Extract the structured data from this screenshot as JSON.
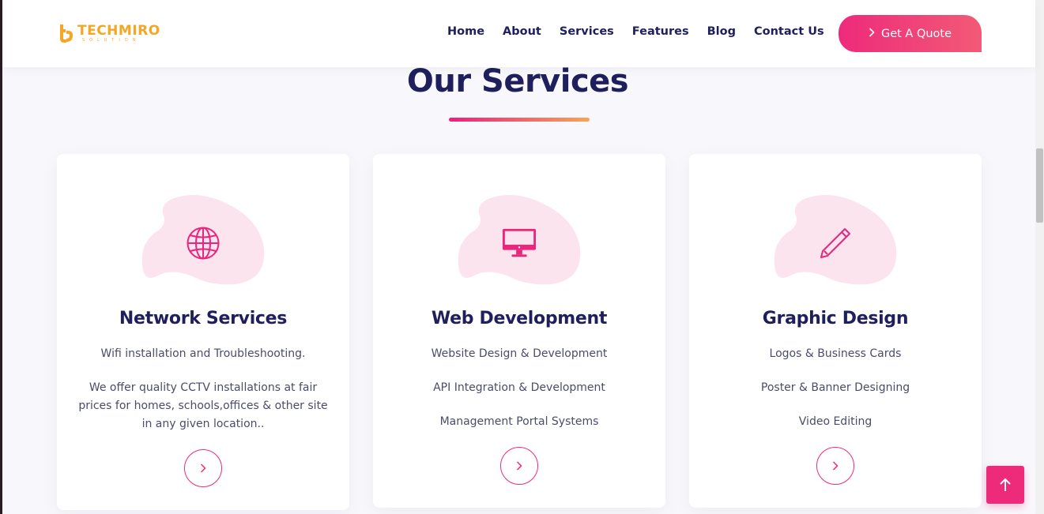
{
  "brand": {
    "logo_text": "TECHMIRO",
    "logo_subtext": "SOLUTION",
    "logo_color": "#f5a623"
  },
  "nav": {
    "items": [
      {
        "label": "Home"
      },
      {
        "label": "About"
      },
      {
        "label": "Services"
      },
      {
        "label": "Features"
      },
      {
        "label": "Blog"
      },
      {
        "label": "Contact Us"
      }
    ],
    "cta_label": "Get A Quote",
    "cta_icon": "chevron-right-icon"
  },
  "section": {
    "title": "Our Services"
  },
  "services": [
    {
      "title": "Network Services",
      "icon": "globe-icon",
      "lines": [
        "Wifi installation and Troubleshooting.",
        "We offer quality CCTV installations at fair prices for homes, schools,offices & other site in any given location.."
      ]
    },
    {
      "title": "Web Development",
      "icon": "monitor-icon",
      "lines": [
        "Website Design & Development",
        "API Integration & Development",
        "Management Portal Systems"
      ]
    },
    {
      "title": "Graphic Design",
      "icon": "pencil-icon",
      "lines": [
        "Logos & Business Cards",
        "Poster & Banner Designing",
        "Video Editing"
      ]
    }
  ],
  "colors": {
    "primary": "#1e1f5c",
    "accent": "#ee2a7b",
    "accent_end": "#f6a45a",
    "blob": "#fce4ef"
  },
  "back_to_top_icon": "arrow-up-icon"
}
